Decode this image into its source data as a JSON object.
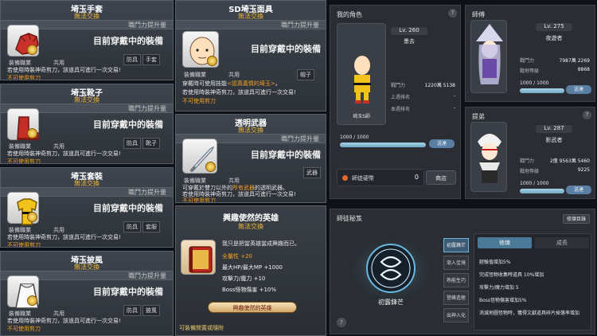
{
  "cards": [
    {
      "title": "埼玉手套",
      "trade": "無法交換",
      "power": "職鬥力提升量",
      "equipped": "目前穿戴中的裝備",
      "job": "裝備職業",
      "common": "共用",
      "tags": [
        "防具",
        "手套"
      ],
      "desc": "若使用時裝神奇剪刀，該道具可進行一次交易!",
      "notrade": "不可使用剪刀",
      "icon": "glove-icon"
    },
    {
      "title": "埼玉靴子",
      "trade": "無法交換",
      "power": "職鬥力提升量",
      "equipped": "目前穿戴中的裝備",
      "job": "裝備職業",
      "common": "共用",
      "tags": [
        "防具",
        "靴子"
      ],
      "desc": "若使用時裝神奇剪刀，該道具可進行一次交易!",
      "notrade": "不可使用剪刀",
      "icon": "boot-icon"
    },
    {
      "title": "埼玉套裝",
      "trade": "無法交換",
      "power": "職鬥力提升量",
      "equipped": "目前穿戴中的裝備",
      "job": "裝備職業",
      "common": "共用",
      "tags": [
        "防具",
        "套服"
      ],
      "desc": "若使用時裝神奇剪刀，該道具可進行一次交易!",
      "notrade": "不可使用剪刀",
      "icon": "suit-icon"
    },
    {
      "title": "埼玉披風",
      "trade": "無法交換",
      "power": "職鬥力提升量",
      "equipped": "目前穿戴中的裝備",
      "job": "裝備職業",
      "common": "共用",
      "tags": [
        "防具",
        "披風"
      ],
      "desc": "若使用時裝神奇剪刀，該道具可進行一次交易!",
      "notrade": "不可使用剪刀",
      "icon": "cape-icon"
    }
  ],
  "mask_card": {
    "title": "SD埼玉面具",
    "trade": "無法交換",
    "power": "職鬥力提升量",
    "equipped": "目前穿戴中的裝備",
    "job": "裝備職業",
    "common": "共用",
    "tags": [
      "帽子"
    ],
    "desc1_a": "穿戴時可使用技能",
    "desc1_b": "<認真義情的埼玉>",
    "desc1_c": "。",
    "desc2": "若使用時裝神奇剪刀，該道具可進行一次交易!",
    "notrade": "不可使用剪刀",
    "icon": "bald-face-icon"
  },
  "weapon_card": {
    "title": "透明武器",
    "trade": "無法交換",
    "power": "職鬥力提升量",
    "equipped": "目前穿戴中的裝備",
    "job": "裝備職業",
    "common": "共用",
    "tags": [
      "武器"
    ],
    "desc1_a": "可穿戴於雙刀以外的",
    "desc1_b": "所有武器",
    "desc1_c": "的透明武器。",
    "desc2": "若使用時裝神奇剪刀，該道具可進行一次交易!",
    "notrade": "不可使用剪刀",
    "icon": "sword-icon"
  },
  "medal_card": {
    "title": "興趣使然的英雄",
    "trade": "無法交換",
    "desc": "我只是把當英雄當成興趣而已。",
    "stats": [
      "全屬性 +20",
      "最大HP/最大MP +1000",
      "攻擊力/魔力 +10",
      "Boss怪物傷害 +10%"
    ],
    "medal_name": "興趣使然的英雄",
    "footer": "可裝備閒置或隨附",
    "icon": "medal-book-icon"
  },
  "my_char": {
    "header": "我的角色",
    "level": "Lv. 260",
    "name": "墨去",
    "char_name": "埼玉S師",
    "stats": [
      {
        "label": "戰鬥力",
        "value": "1220萬 5138"
      },
      {
        "label": "上週排名",
        "value": "-"
      },
      {
        "label": "本週排名",
        "value": "-"
      }
    ],
    "hp": "1000 / 1000",
    "hp_fraction": 1.0,
    "send": "送達",
    "currency_label": "師徒硬幣",
    "currency_value": "0",
    "shop": "商店"
  },
  "mentor": {
    "header": "師傅",
    "level": "Lv. 275",
    "name": "夜遊者",
    "stats": [
      {
        "label": "戰鬥力",
        "value": "7987萬 2269"
      },
      {
        "label": "戰地等級",
        "value": "8868"
      }
    ],
    "hp": "1000 / 1000",
    "hp_fraction": 1.0,
    "send": "送達"
  },
  "disciple": {
    "header": "提弟",
    "level": "Lv. 287",
    "name": "影武者",
    "stats": [
      {
        "label": "戰鬥力",
        "value": "2億 9563萬 5460"
      },
      {
        "label": "戰地等級",
        "value": "9225"
      }
    ],
    "hp": "1000 / 1000",
    "hp_fraction": 1.0,
    "send": "送達"
  },
  "secret": {
    "header": "師徒秘笈",
    "manage": "修煉目錄",
    "skill_name": "初露鋒芒",
    "side_buttons": [
      "初露鋒芒",
      "漸入佳境",
      "熟能生巧",
      "登峰造極",
      "出神入化"
    ],
    "tabs": [
      "修煉",
      "成長"
    ],
    "effects": [
      "經驗值增加5%",
      "完成怪物收集時道具 10%增加",
      "攻擊力/魔力增加 5",
      "Boss怪物傷害增加5%",
      "消滅地圖怪物時，獲得文獻道具碎片掉落率增加"
    ],
    "help": "?"
  }
}
